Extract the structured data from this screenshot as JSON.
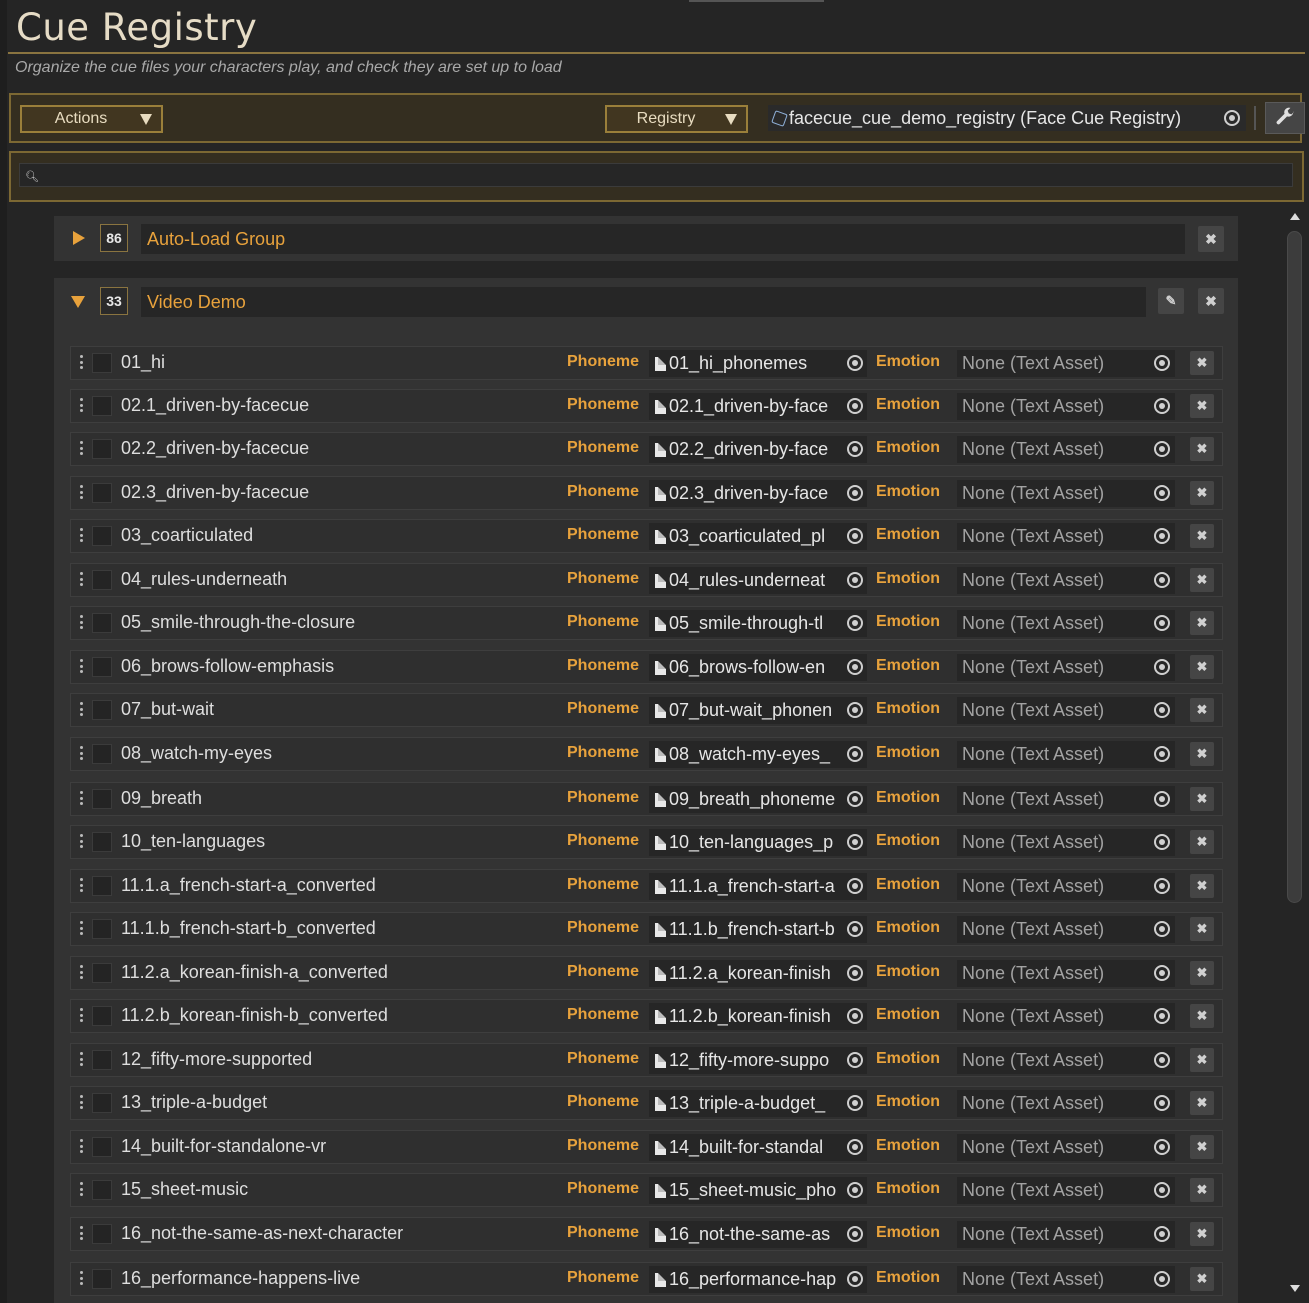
{
  "header": {
    "title": "Cue Registry",
    "subtitle": "Organize the cue files your characters play, and check they are set up to load"
  },
  "toolbar": {
    "actions_label": "Actions",
    "registry_label": "Registry",
    "registry_value": "facecue_cue_demo_registry (Face Cue Registry)",
    "wrench_icon": "wrench-icon"
  },
  "search": {
    "value": "",
    "placeholder": ""
  },
  "groups": [
    {
      "count": "86",
      "name": "Auto-Load Group",
      "expanded": false
    },
    {
      "count": "33",
      "name": "Video Demo",
      "expanded": true
    }
  ],
  "labels": {
    "phoneme": "Phoneme",
    "emotion": "Emotion",
    "emotion_none": "None (Text Asset)"
  },
  "cues": [
    {
      "name": "01_hi",
      "phoneme": "01_hi_phonemes"
    },
    {
      "name": "02.1_driven-by-facecue",
      "phoneme": "02.1_driven-by-face"
    },
    {
      "name": "02.2_driven-by-facecue",
      "phoneme": "02.2_driven-by-face"
    },
    {
      "name": "02.3_driven-by-facecue",
      "phoneme": "02.3_driven-by-face"
    },
    {
      "name": "03_coarticulated",
      "phoneme": "03_coarticulated_pl"
    },
    {
      "name": "04_rules-underneath",
      "phoneme": "04_rules-underneat"
    },
    {
      "name": "05_smile-through-the-closure",
      "phoneme": "05_smile-through-tl"
    },
    {
      "name": "06_brows-follow-emphasis",
      "phoneme": "06_brows-follow-en"
    },
    {
      "name": "07_but-wait",
      "phoneme": "07_but-wait_phonen"
    },
    {
      "name": "08_watch-my-eyes",
      "phoneme": "08_watch-my-eyes_"
    },
    {
      "name": "09_breath",
      "phoneme": "09_breath_phoneme"
    },
    {
      "name": "10_ten-languages",
      "phoneme": "10_ten-languages_p"
    },
    {
      "name": "11.1.a_french-start-a_converted",
      "phoneme": "11.1.a_french-start-a"
    },
    {
      "name": "11.1.b_french-start-b_converted",
      "phoneme": "11.1.b_french-start-b"
    },
    {
      "name": "11.2.a_korean-finish-a_converted",
      "phoneme": "11.2.a_korean-finish"
    },
    {
      "name": "11.2.b_korean-finish-b_converted",
      "phoneme": "11.2.b_korean-finish"
    },
    {
      "name": "12_fifty-more-supported",
      "phoneme": "12_fifty-more-suppo"
    },
    {
      "name": "13_triple-a-budget",
      "phoneme": "13_triple-a-budget_"
    },
    {
      "name": "14_built-for-standalone-vr",
      "phoneme": "14_built-for-standal"
    },
    {
      "name": "15_sheet-music",
      "phoneme": "15_sheet-music_pho"
    },
    {
      "name": "16_not-the-same-as-next-character",
      "phoneme": "16_not-the-same-as"
    },
    {
      "name": "16_performance-happens-live",
      "phoneme": "16_performance-hap"
    }
  ],
  "colors": {
    "accent": "#e8a23c",
    "gold_border": "#7c6833",
    "background": "#252525"
  }
}
